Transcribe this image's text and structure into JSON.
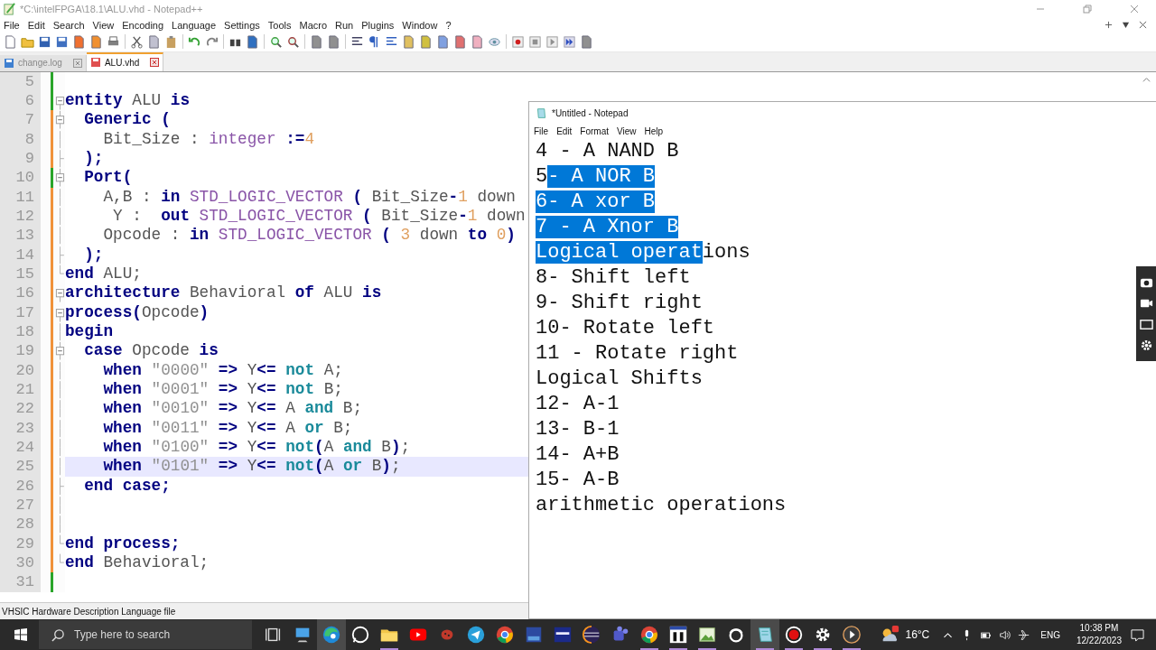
{
  "window": {
    "title": "*C:\\intelFPGA\\18.1\\ALU.vhd - Notepad++"
  },
  "menu": [
    "File",
    "Edit",
    "Search",
    "View",
    "Encoding",
    "Language",
    "Settings",
    "Tools",
    "Macro",
    "Run",
    "Plugins",
    "Window",
    "?"
  ],
  "tabs": [
    {
      "label": "change.log",
      "selected": false,
      "modified": false
    },
    {
      "label": "ALU.vhd",
      "selected": true,
      "modified": true
    }
  ],
  "editor": {
    "lines": [
      {
        "number": "5",
        "fold_start": false,
        "fold_end": false,
        "in_block": false,
        "saved": true,
        "current": false
      },
      {
        "number": "6",
        "fold_start": true,
        "fold_end": false,
        "in_block": false,
        "saved": true,
        "current": false,
        "tokens": [
          {
            "kind": "keyword",
            "text": "entity"
          },
          {
            "kind": "plain",
            "text": " ALU "
          },
          {
            "kind": "keyword",
            "text": "is"
          }
        ]
      },
      {
        "number": "7",
        "fold_start": true,
        "fold_end": false,
        "in_block": true,
        "saved": false,
        "current": false,
        "tokens": [
          {
            "kind": "keyword",
            "text": "  Generic ("
          }
        ]
      },
      {
        "number": "8",
        "fold_start": false,
        "fold_end": false,
        "in_block": true,
        "saved": false,
        "current": false,
        "tokens": [
          {
            "kind": "plain",
            "text": "    Bit_Size : "
          },
          {
            "kind": "type",
            "text": "integer"
          },
          {
            "kind": "keyword",
            "text": " :="
          },
          {
            "kind": "number",
            "text": "4"
          }
        ]
      },
      {
        "number": "9",
        "fold_start": false,
        "fold_end": true,
        "in_block": true,
        "saved": false,
        "current": false,
        "tokens": [
          {
            "kind": "keyword",
            "text": "  );"
          }
        ]
      },
      {
        "number": "10",
        "fold_start": true,
        "fold_end": false,
        "in_block": true,
        "saved": true,
        "current": false,
        "tokens": [
          {
            "kind": "keyword",
            "text": "  Port("
          }
        ]
      },
      {
        "number": "11",
        "fold_start": false,
        "fold_end": false,
        "in_block": true,
        "saved": false,
        "current": false,
        "tokens": [
          {
            "kind": "plain",
            "text": "    A,B : "
          },
          {
            "kind": "keyword",
            "text": "in"
          },
          {
            "kind": "type",
            "text": " STD_LOGIC_VECTOR "
          },
          {
            "kind": "keyword",
            "text": "("
          },
          {
            "kind": "plain",
            "text": " Bit_Size"
          },
          {
            "kind": "keyword",
            "text": "-"
          },
          {
            "kind": "number",
            "text": "1"
          },
          {
            "kind": "plain",
            "text": " down"
          }
        ]
      },
      {
        "number": "12",
        "fold_start": false,
        "fold_end": false,
        "in_block": true,
        "saved": false,
        "current": false,
        "tokens": [
          {
            "kind": "plain",
            "text": "     Y :  "
          },
          {
            "kind": "keyword",
            "text": "out"
          },
          {
            "kind": "type",
            "text": " STD_LOGIC_VECTOR "
          },
          {
            "kind": "keyword",
            "text": "("
          },
          {
            "kind": "plain",
            "text": " Bit_Size"
          },
          {
            "kind": "keyword",
            "text": "-"
          },
          {
            "kind": "number",
            "text": "1"
          },
          {
            "kind": "plain",
            "text": " down"
          }
        ]
      },
      {
        "number": "13",
        "fold_start": false,
        "fold_end": false,
        "in_block": true,
        "saved": false,
        "current": false,
        "tokens": [
          {
            "kind": "plain",
            "text": "    Opcode : "
          },
          {
            "kind": "keyword",
            "text": "in"
          },
          {
            "kind": "type",
            "text": " STD_LOGIC_VECTOR "
          },
          {
            "kind": "keyword",
            "text": "("
          },
          {
            "kind": "number",
            "text": " 3"
          },
          {
            "kind": "plain",
            "text": " down "
          },
          {
            "kind": "keyword",
            "text": "to"
          },
          {
            "kind": "number",
            "text": " 0"
          },
          {
            "kind": "keyword",
            "text": ")"
          }
        ]
      },
      {
        "number": "14",
        "fold_start": false,
        "fold_end": true,
        "in_block": true,
        "saved": false,
        "current": false,
        "tokens": [
          {
            "kind": "keyword",
            "text": "  );"
          }
        ]
      },
      {
        "number": "15",
        "fold_start": false,
        "fold_end": true,
        "in_block": false,
        "saved": false,
        "current": false,
        "tokens": [
          {
            "kind": "keyword",
            "text": "end"
          },
          {
            "kind": "plain",
            "text": " ALU;"
          }
        ]
      },
      {
        "number": "16",
        "fold_start": true,
        "fold_end": false,
        "in_block": false,
        "saved": false,
        "current": false,
        "tokens": [
          {
            "kind": "keyword",
            "text": "architecture"
          },
          {
            "kind": "plain",
            "text": " Behavioral "
          },
          {
            "kind": "keyword",
            "text": "of"
          },
          {
            "kind": "plain",
            "text": " ALU "
          },
          {
            "kind": "keyword",
            "text": "is"
          }
        ]
      },
      {
        "number": "17",
        "fold_start": true,
        "fold_end": false,
        "in_block": false,
        "saved": false,
        "current": false,
        "tokens": [
          {
            "kind": "keyword",
            "text": "process("
          },
          {
            "kind": "plain",
            "text": "Opcode"
          },
          {
            "kind": "keyword",
            "text": ")"
          }
        ]
      },
      {
        "number": "18",
        "fold_start": false,
        "fold_end": false,
        "in_block": true,
        "saved": false,
        "current": false,
        "tokens": [
          {
            "kind": "keyword",
            "text": "begin"
          }
        ]
      },
      {
        "number": "19",
        "fold_start": true,
        "fold_end": false,
        "in_block": true,
        "saved": false,
        "current": false,
        "tokens": [
          {
            "kind": "keyword",
            "text": "  case"
          },
          {
            "kind": "plain",
            "text": " Opcode "
          },
          {
            "kind": "keyword",
            "text": "is"
          }
        ]
      },
      {
        "number": "20",
        "fold_start": false,
        "fold_end": false,
        "in_block": true,
        "saved": false,
        "current": false,
        "tokens": [
          {
            "kind": "keyword",
            "text": "    when"
          },
          {
            "kind": "string",
            "text": " \"0000\" "
          },
          {
            "kind": "keyword",
            "text": "=>"
          },
          {
            "kind": "plain",
            "text": " Y"
          },
          {
            "kind": "keyword",
            "text": "<="
          },
          {
            "kind": "operator",
            "text": " not"
          },
          {
            "kind": "plain",
            "text": " A;"
          }
        ]
      },
      {
        "number": "21",
        "fold_start": false,
        "fold_end": false,
        "in_block": true,
        "saved": false,
        "current": false,
        "tokens": [
          {
            "kind": "keyword",
            "text": "    when"
          },
          {
            "kind": "string",
            "text": " \"0001\" "
          },
          {
            "kind": "keyword",
            "text": "=>"
          },
          {
            "kind": "plain",
            "text": " Y"
          },
          {
            "kind": "keyword",
            "text": "<="
          },
          {
            "kind": "operator",
            "text": " not"
          },
          {
            "kind": "plain",
            "text": " B;"
          }
        ]
      },
      {
        "number": "22",
        "fold_start": false,
        "fold_end": false,
        "in_block": true,
        "saved": false,
        "current": false,
        "tokens": [
          {
            "kind": "keyword",
            "text": "    when"
          },
          {
            "kind": "string",
            "text": " \"0010\" "
          },
          {
            "kind": "keyword",
            "text": "=>"
          },
          {
            "kind": "plain",
            "text": " Y"
          },
          {
            "kind": "keyword",
            "text": "<="
          },
          {
            "kind": "plain",
            "text": " A "
          },
          {
            "kind": "operator",
            "text": "and"
          },
          {
            "kind": "plain",
            "text": " B;"
          }
        ]
      },
      {
        "number": "23",
        "fold_start": false,
        "fold_end": false,
        "in_block": true,
        "saved": false,
        "current": false,
        "tokens": [
          {
            "kind": "keyword",
            "text": "    when"
          },
          {
            "kind": "string",
            "text": " \"0011\" "
          },
          {
            "kind": "keyword",
            "text": "=>"
          },
          {
            "kind": "plain",
            "text": " Y"
          },
          {
            "kind": "keyword",
            "text": "<="
          },
          {
            "kind": "plain",
            "text": " A "
          },
          {
            "kind": "operator",
            "text": "or"
          },
          {
            "kind": "plain",
            "text": " B;"
          }
        ]
      },
      {
        "number": "24",
        "fold_start": false,
        "fold_end": false,
        "in_block": true,
        "saved": false,
        "current": false,
        "tokens": [
          {
            "kind": "keyword",
            "text": "    when"
          },
          {
            "kind": "string",
            "text": " \"0100\" "
          },
          {
            "kind": "keyword",
            "text": "=>"
          },
          {
            "kind": "plain",
            "text": " Y"
          },
          {
            "kind": "keyword",
            "text": "<="
          },
          {
            "kind": "operator",
            "text": " not"
          },
          {
            "kind": "keyword",
            "text": "("
          },
          {
            "kind": "plain",
            "text": "A "
          },
          {
            "kind": "operator",
            "text": "and"
          },
          {
            "kind": "plain",
            "text": " B"
          },
          {
            "kind": "keyword",
            "text": ")"
          },
          {
            "kind": "plain",
            "text": ";"
          }
        ]
      },
      {
        "number": "25",
        "fold_start": false,
        "fold_end": false,
        "in_block": true,
        "saved": false,
        "current": true,
        "tokens": [
          {
            "kind": "keyword",
            "text": "    when"
          },
          {
            "kind": "string",
            "text": " \"0101\" "
          },
          {
            "kind": "keyword",
            "text": "=>"
          },
          {
            "kind": "plain",
            "text": " Y"
          },
          {
            "kind": "keyword",
            "text": "<="
          },
          {
            "kind": "operator",
            "text": " not"
          },
          {
            "kind": "keyword",
            "text": "("
          },
          {
            "kind": "plain",
            "text": "A "
          },
          {
            "kind": "operator",
            "text": "or"
          },
          {
            "kind": "plain",
            "text": " B"
          },
          {
            "kind": "keyword",
            "text": ")"
          },
          {
            "kind": "plain",
            "text": ";"
          }
        ]
      },
      {
        "number": "26",
        "fold_start": false,
        "fold_end": true,
        "in_block": true,
        "saved": false,
        "current": false,
        "tokens": [
          {
            "kind": "keyword",
            "text": "  end case;"
          }
        ]
      },
      {
        "number": "27",
        "fold_start": false,
        "fold_end": false,
        "in_block": true,
        "saved": false,
        "current": false
      },
      {
        "number": "28",
        "fold_start": false,
        "fold_end": false,
        "in_block": true,
        "saved": false,
        "current": false
      },
      {
        "number": "29",
        "fold_start": false,
        "fold_end": true,
        "in_block": false,
        "saved": false,
        "current": false,
        "tokens": [
          {
            "kind": "keyword",
            "text": "end process;"
          }
        ]
      },
      {
        "number": "30",
        "fold_start": false,
        "fold_end": true,
        "in_block": false,
        "saved": false,
        "current": false,
        "tokens": [
          {
            "kind": "keyword",
            "text": "end"
          },
          {
            "kind": "plain",
            "text": " Behavioral;"
          }
        ]
      },
      {
        "number": "31",
        "fold_start": false,
        "fold_end": false,
        "in_block": false,
        "saved": true,
        "current": false
      }
    ]
  },
  "status_bar": {
    "file_type": "VHSIC Hardware Description Language file"
  },
  "notepad": {
    "title": "*Untitled - Notepad",
    "menu": [
      "File",
      "Edit",
      "Format",
      "View",
      "Help"
    ],
    "lines": [
      {
        "segments": [
          {
            "text": "4 - A NAND B",
            "selected": false
          }
        ]
      },
      {
        "segments": [
          {
            "text": "5",
            "selected": false
          },
          {
            "text": "- A NOR B",
            "selected": true
          }
        ]
      },
      {
        "segments": [
          {
            "text": "6- A xor B",
            "selected": true
          }
        ]
      },
      {
        "segments": [
          {
            "text": "7 - A Xnor B",
            "selected": true
          }
        ]
      },
      {
        "segments": [
          {
            "text": "Logical operat",
            "selected": true
          },
          {
            "text": "ions",
            "selected": false
          }
        ]
      },
      {
        "segments": [
          {
            "text": "8- Shift left",
            "selected": false
          }
        ]
      },
      {
        "segments": [
          {
            "text": "9- Shift right",
            "selected": false
          }
        ]
      },
      {
        "segments": [
          {
            "text": "10- Rotate left",
            "selected": false
          }
        ]
      },
      {
        "segments": [
          {
            "text": "11 - Rotate right",
            "selected": false
          }
        ]
      },
      {
        "segments": [
          {
            "text": "Logical Shifts",
            "selected": false
          }
        ]
      },
      {
        "segments": [
          {
            "text": "12- A-1",
            "selected": false
          }
        ]
      },
      {
        "segments": [
          {
            "text": "13- B-1",
            "selected": false
          }
        ]
      },
      {
        "segments": [
          {
            "text": "14- A+B",
            "selected": false
          }
        ]
      },
      {
        "segments": [
          {
            "text": "15- A-B",
            "selected": false
          }
        ]
      },
      {
        "segments": [
          {
            "text": "arithmetic operations",
            "selected": false
          }
        ]
      }
    ]
  },
  "taskbar": {
    "search": {
      "placeholder": "Type here to search"
    },
    "apps": [
      {
        "kind": "taskview",
        "running": false,
        "selected": false
      },
      {
        "kind": "computer",
        "running": false,
        "selected": false
      },
      {
        "kind": "edge",
        "running": false,
        "selected": true
      },
      {
        "kind": "chat",
        "running": false,
        "selected": false
      },
      {
        "kind": "folder",
        "running": true,
        "selected": false
      },
      {
        "kind": "video",
        "running": false,
        "selected": false
      },
      {
        "kind": "ladybug",
        "running": false,
        "selected": false
      },
      {
        "kind": "plane",
        "running": false,
        "selected": false
      },
      {
        "kind": "browser",
        "running": false,
        "selected": false
      },
      {
        "kind": "tile",
        "running": false,
        "selected": false
      },
      {
        "kind": "tile2",
        "running": false,
        "selected": false
      },
      {
        "kind": "eclipse",
        "running": false,
        "selected": false
      },
      {
        "kind": "team",
        "running": false,
        "selected": false
      },
      {
        "kind": "browser",
        "running": true,
        "selected": false
      },
      {
        "kind": "mtile",
        "running": true,
        "selected": false
      },
      {
        "kind": "image",
        "running": true,
        "selected": false
      },
      {
        "kind": "ring",
        "running": false,
        "selected": false
      },
      {
        "kind": "notepad",
        "running": true,
        "selected": true
      },
      {
        "kind": "record",
        "running": true,
        "selected": false
      },
      {
        "kind": "gear",
        "running": true,
        "selected": false
      },
      {
        "kind": "play",
        "running": true,
        "selected": false
      }
    ],
    "temperature": "16°C",
    "language": "ENG",
    "time": "10:38 PM",
    "date": "12/22/2023"
  }
}
